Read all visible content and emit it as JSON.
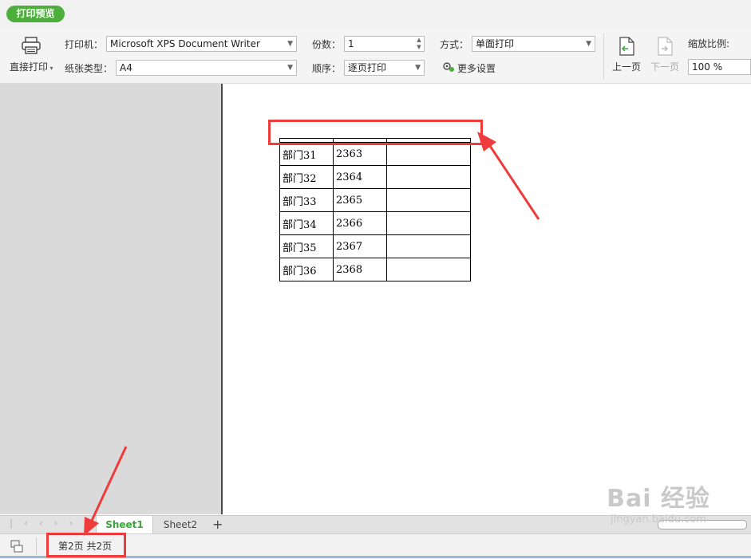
{
  "app": {
    "preview_badge": "打印预览"
  },
  "toolbar": {
    "direct_print": "直接打印",
    "printer_label": "打印机：",
    "printer_value": "Microsoft XPS Document Writer",
    "paper_label": "纸张类型：",
    "paper_value": "A4",
    "copies_label": "份数：",
    "copies_value": "1",
    "order_label": "顺序：",
    "order_value": "逐页打印",
    "mode_label": "方式：",
    "mode_value": "单面打印",
    "more_settings": "更多设置",
    "prev_page": "上一页",
    "next_page": "下一页",
    "zoom_label": "缩放比例:",
    "zoom_value": "100 %"
  },
  "sheet_table": {
    "rows": [
      [
        "部门31",
        "2363",
        ""
      ],
      [
        "部门32",
        "2364",
        ""
      ],
      [
        "部门33",
        "2365",
        ""
      ],
      [
        "部门34",
        "2366",
        ""
      ],
      [
        "部门35",
        "2367",
        ""
      ],
      [
        "部门36",
        "2368",
        ""
      ]
    ]
  },
  "tabs": {
    "sheet1": "Sheet1",
    "sheet2": "Sheet2",
    "add": "+"
  },
  "status": {
    "page_info": "第2页 共2页"
  },
  "watermark": {
    "brand": "Bai 经验",
    "url": "jingyan.baidu.com"
  },
  "colors": {
    "accent_green": "#4caf3c",
    "annotation_red": "#ee3b3b"
  }
}
